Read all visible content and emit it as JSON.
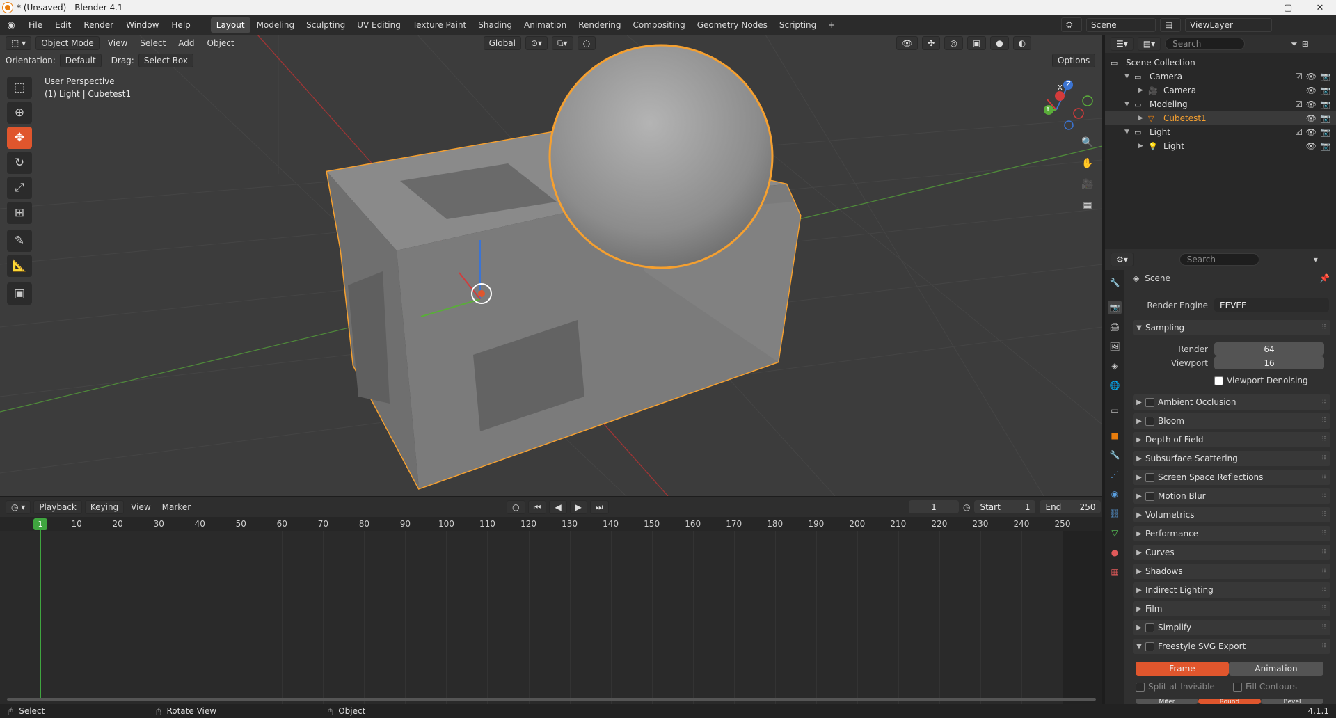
{
  "window": {
    "title": "* (Unsaved) - Blender 4.1",
    "min": "—",
    "max": "▢",
    "close": "✕"
  },
  "menu": [
    "File",
    "Edit",
    "Render",
    "Window",
    "Help"
  ],
  "workspaces": [
    "Layout",
    "Modeling",
    "Sculpting",
    "UV Editing",
    "Texture Paint",
    "Shading",
    "Animation",
    "Rendering",
    "Compositing",
    "Geometry Nodes",
    "Scripting"
  ],
  "add_tab": "+",
  "scene": {
    "name": "Scene",
    "viewlayer": "ViewLayer"
  },
  "viewport": {
    "mode": "Object Mode",
    "menus": [
      "View",
      "Select",
      "Add",
      "Object"
    ],
    "transform": "Global",
    "orientation_label": "Orientation:",
    "orientation": "Default",
    "drag_label": "Drag:",
    "drag": "Select Box",
    "options": "Options",
    "view_name": "User Perspective",
    "context": "(1) Light | Cubetest1",
    "gizmo": {
      "x": "X",
      "y": "Y",
      "z": "Z"
    }
  },
  "timeline": {
    "menus": [
      "Playback",
      "Keying",
      "View",
      "Marker"
    ],
    "current_frame": "1",
    "start_label": "Start",
    "start": "1",
    "end_label": "End",
    "end": "250",
    "ticks": [
      "1",
      "10",
      "20",
      "30",
      "40",
      "50",
      "60",
      "70",
      "80",
      "90",
      "100",
      "110",
      "120",
      "130",
      "140",
      "150",
      "160",
      "170",
      "180",
      "190",
      "200",
      "210",
      "220",
      "230",
      "240",
      "250"
    ]
  },
  "status": {
    "select": "Select",
    "rotate": "Rotate View",
    "object": "Object",
    "version": "4.1.1"
  },
  "outliner": {
    "search": "Search",
    "rows": [
      {
        "label": "Scene Collection",
        "indent": 0,
        "type": "scene"
      },
      {
        "label": "Camera",
        "indent": 1,
        "type": "collection"
      },
      {
        "label": "Camera",
        "indent": 2,
        "type": "camera"
      },
      {
        "label": "Modeling",
        "indent": 1,
        "type": "collection"
      },
      {
        "label": "Cubetest1",
        "indent": 2,
        "type": "mesh"
      },
      {
        "label": "Light",
        "indent": 1,
        "type": "collection"
      },
      {
        "label": "Light",
        "indent": 2,
        "type": "light"
      }
    ]
  },
  "properties": {
    "search": "Search",
    "scene": "Scene",
    "engine_label": "Render Engine",
    "engine": "EEVEE",
    "sampling": "Sampling",
    "render_label": "Render",
    "render": "64",
    "viewport_label": "Viewport",
    "viewport": "16",
    "denoise": "Viewport Denoising",
    "panels": [
      {
        "label": "Ambient Occlusion",
        "checkbox": true
      },
      {
        "label": "Bloom",
        "checkbox": true
      },
      {
        "label": "Depth of Field",
        "checkbox": false
      },
      {
        "label": "Subsurface Scattering",
        "checkbox": false
      },
      {
        "label": "Screen Space Reflections",
        "checkbox": true
      },
      {
        "label": "Motion Blur",
        "checkbox": true
      },
      {
        "label": "Volumetrics",
        "checkbox": false
      },
      {
        "label": "Performance",
        "checkbox": false
      },
      {
        "label": "Curves",
        "checkbox": false
      },
      {
        "label": "Shadows",
        "checkbox": false
      },
      {
        "label": "Indirect Lighting",
        "checkbox": false
      },
      {
        "label": "Film",
        "checkbox": false
      },
      {
        "label": "Simplify",
        "checkbox": true
      },
      {
        "label": "Freestyle SVG Export",
        "checkbox": true
      }
    ],
    "frame": "Frame",
    "animation": "Animation",
    "split": "Split at Invisible",
    "fill": "Fill Contours",
    "miter": "Miter",
    "round": "Round",
    "bevel": "Bevel"
  },
  "colors": {
    "accent": "#e0562d",
    "select": "#f5a030",
    "axis_x": "#d33b3b",
    "axis_y": "#5aad3a",
    "axis_z": "#3b74d3"
  }
}
